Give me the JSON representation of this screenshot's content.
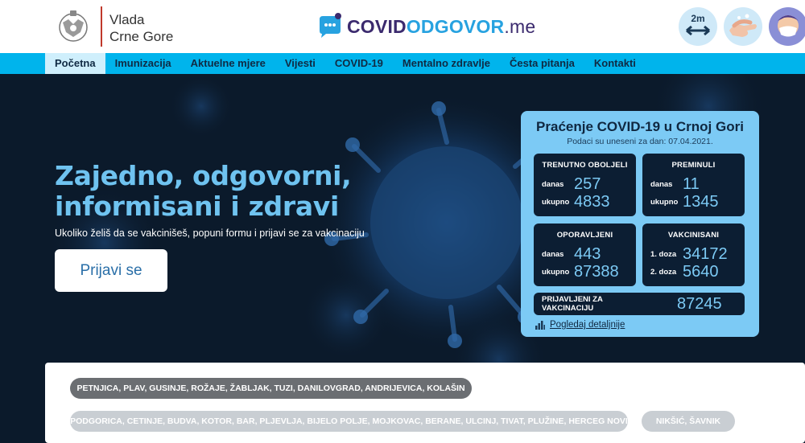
{
  "header": {
    "gov_line1": "Vlada",
    "gov_line2": "Crne Gore",
    "logo_part1": "COVID",
    "logo_part2": "ODGOVOR",
    "logo_part3": ".me",
    "tips": [
      {
        "icon": "distance-2m-icon",
        "text": "2m"
      },
      {
        "icon": "hand-wash-icon"
      },
      {
        "icon": "face-mask-icon"
      }
    ]
  },
  "nav": {
    "items": [
      "Početna",
      "Imunizacija",
      "Aktuelne mjere",
      "Vijesti",
      "COVID-19",
      "Mentalno zdravlje",
      "Česta pitanja",
      "Kontakti"
    ],
    "active_index": 0
  },
  "hero": {
    "title_line1": "Zajedno, odgovorni,",
    "title_line2": "informisani i zdravi",
    "subtitle": "Ukoliko želiš da se vakcinišeš, popuni formu i prijavi se za vakcinaciju",
    "button": "Prijavi se"
  },
  "stats": {
    "title": "Praćenje COVID-19 u Crnoj Gori",
    "date": "Podaci su uneseni za dan: 07.04.2021.",
    "active": {
      "head": "TRENUTNO OBOLJELI",
      "today_label": "danas",
      "today": "257",
      "total_label": "ukupno",
      "total": "4833"
    },
    "deaths": {
      "head": "PREMINULI",
      "today_label": "danas",
      "today": "11",
      "total_label": "ukupno",
      "total": "1345"
    },
    "recovered": {
      "head": "OPORAVLJENI",
      "today_label": "danas",
      "today": "443",
      "total_label": "ukupno",
      "total": "87388"
    },
    "vaccinated": {
      "head": "VAKCINISANI",
      "dose1_label": "1. doza",
      "dose1": "34172",
      "dose2_label": "2. doza",
      "dose2": "5640"
    },
    "registered": {
      "label": "PRIJAVLJENI ZA VAKCINACIJU",
      "value": "87245"
    },
    "details_link": "Pogledaj detaljnije"
  },
  "municipalities": {
    "group1": "PETNJICA, PLAV, GUSINJE, ROŽAJE, ŽABLJAK, TUZI, DANILOVGRAD, ANDRIJEVICA, KOLAŠIN",
    "group2": "PODGORICA, CETINJE, BUDVA, KOTOR, BAR, PLJEVLJA, BIJELO POLJE, MOJKOVAC, BERANE, ULCINJ, TIVAT, PLUŽINE, HERCEG NOVI",
    "group3": "NIKŠIĆ, ŠAVNIK"
  },
  "colors": {
    "nav_bg": "#00b4ec",
    "accent_blue": "#27a2e0",
    "brand_purple": "#3b2a6e",
    "hero_bg": "#0b1a2b",
    "stats_bg": "#7ccaf5",
    "card_bg": "#0c1e33"
  }
}
